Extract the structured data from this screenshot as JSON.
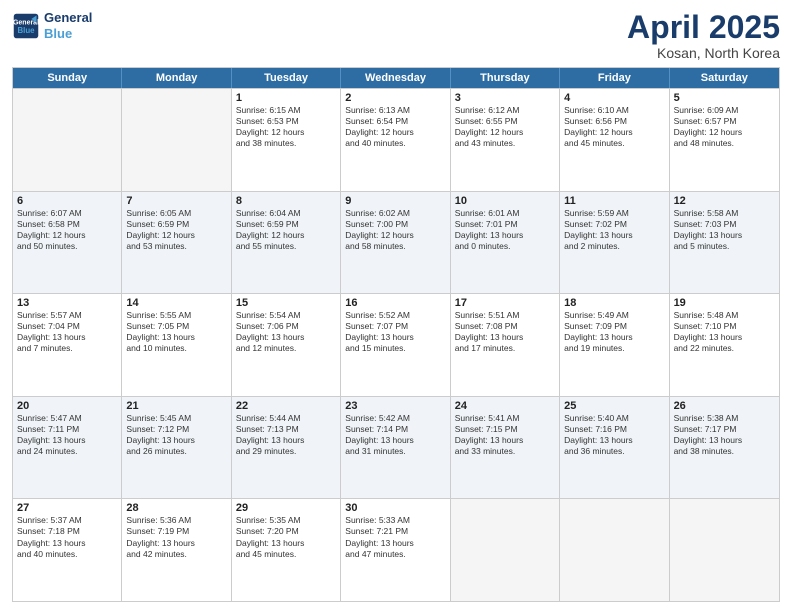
{
  "header": {
    "logo_line1": "General",
    "logo_line2": "Blue",
    "month": "April 2025",
    "location": "Kosan, North Korea"
  },
  "weekdays": [
    "Sunday",
    "Monday",
    "Tuesday",
    "Wednesday",
    "Thursday",
    "Friday",
    "Saturday"
  ],
  "rows": [
    [
      {
        "day": "",
        "lines": [],
        "empty": true
      },
      {
        "day": "",
        "lines": [],
        "empty": true
      },
      {
        "day": "1",
        "lines": [
          "Sunrise: 6:15 AM",
          "Sunset: 6:53 PM",
          "Daylight: 12 hours",
          "and 38 minutes."
        ]
      },
      {
        "day": "2",
        "lines": [
          "Sunrise: 6:13 AM",
          "Sunset: 6:54 PM",
          "Daylight: 12 hours",
          "and 40 minutes."
        ]
      },
      {
        "day": "3",
        "lines": [
          "Sunrise: 6:12 AM",
          "Sunset: 6:55 PM",
          "Daylight: 12 hours",
          "and 43 minutes."
        ]
      },
      {
        "day": "4",
        "lines": [
          "Sunrise: 6:10 AM",
          "Sunset: 6:56 PM",
          "Daylight: 12 hours",
          "and 45 minutes."
        ]
      },
      {
        "day": "5",
        "lines": [
          "Sunrise: 6:09 AM",
          "Sunset: 6:57 PM",
          "Daylight: 12 hours",
          "and 48 minutes."
        ]
      }
    ],
    [
      {
        "day": "6",
        "lines": [
          "Sunrise: 6:07 AM",
          "Sunset: 6:58 PM",
          "Daylight: 12 hours",
          "and 50 minutes."
        ]
      },
      {
        "day": "7",
        "lines": [
          "Sunrise: 6:05 AM",
          "Sunset: 6:59 PM",
          "Daylight: 12 hours",
          "and 53 minutes."
        ]
      },
      {
        "day": "8",
        "lines": [
          "Sunrise: 6:04 AM",
          "Sunset: 6:59 PM",
          "Daylight: 12 hours",
          "and 55 minutes."
        ]
      },
      {
        "day": "9",
        "lines": [
          "Sunrise: 6:02 AM",
          "Sunset: 7:00 PM",
          "Daylight: 12 hours",
          "and 58 minutes."
        ]
      },
      {
        "day": "10",
        "lines": [
          "Sunrise: 6:01 AM",
          "Sunset: 7:01 PM",
          "Daylight: 13 hours",
          "and 0 minutes."
        ]
      },
      {
        "day": "11",
        "lines": [
          "Sunrise: 5:59 AM",
          "Sunset: 7:02 PM",
          "Daylight: 13 hours",
          "and 2 minutes."
        ]
      },
      {
        "day": "12",
        "lines": [
          "Sunrise: 5:58 AM",
          "Sunset: 7:03 PM",
          "Daylight: 13 hours",
          "and 5 minutes."
        ]
      }
    ],
    [
      {
        "day": "13",
        "lines": [
          "Sunrise: 5:57 AM",
          "Sunset: 7:04 PM",
          "Daylight: 13 hours",
          "and 7 minutes."
        ]
      },
      {
        "day": "14",
        "lines": [
          "Sunrise: 5:55 AM",
          "Sunset: 7:05 PM",
          "Daylight: 13 hours",
          "and 10 minutes."
        ]
      },
      {
        "day": "15",
        "lines": [
          "Sunrise: 5:54 AM",
          "Sunset: 7:06 PM",
          "Daylight: 13 hours",
          "and 12 minutes."
        ]
      },
      {
        "day": "16",
        "lines": [
          "Sunrise: 5:52 AM",
          "Sunset: 7:07 PM",
          "Daylight: 13 hours",
          "and 15 minutes."
        ]
      },
      {
        "day": "17",
        "lines": [
          "Sunrise: 5:51 AM",
          "Sunset: 7:08 PM",
          "Daylight: 13 hours",
          "and 17 minutes."
        ]
      },
      {
        "day": "18",
        "lines": [
          "Sunrise: 5:49 AM",
          "Sunset: 7:09 PM",
          "Daylight: 13 hours",
          "and 19 minutes."
        ]
      },
      {
        "day": "19",
        "lines": [
          "Sunrise: 5:48 AM",
          "Sunset: 7:10 PM",
          "Daylight: 13 hours",
          "and 22 minutes."
        ]
      }
    ],
    [
      {
        "day": "20",
        "lines": [
          "Sunrise: 5:47 AM",
          "Sunset: 7:11 PM",
          "Daylight: 13 hours",
          "and 24 minutes."
        ]
      },
      {
        "day": "21",
        "lines": [
          "Sunrise: 5:45 AM",
          "Sunset: 7:12 PM",
          "Daylight: 13 hours",
          "and 26 minutes."
        ]
      },
      {
        "day": "22",
        "lines": [
          "Sunrise: 5:44 AM",
          "Sunset: 7:13 PM",
          "Daylight: 13 hours",
          "and 29 minutes."
        ]
      },
      {
        "day": "23",
        "lines": [
          "Sunrise: 5:42 AM",
          "Sunset: 7:14 PM",
          "Daylight: 13 hours",
          "and 31 minutes."
        ]
      },
      {
        "day": "24",
        "lines": [
          "Sunrise: 5:41 AM",
          "Sunset: 7:15 PM",
          "Daylight: 13 hours",
          "and 33 minutes."
        ]
      },
      {
        "day": "25",
        "lines": [
          "Sunrise: 5:40 AM",
          "Sunset: 7:16 PM",
          "Daylight: 13 hours",
          "and 36 minutes."
        ]
      },
      {
        "day": "26",
        "lines": [
          "Sunrise: 5:38 AM",
          "Sunset: 7:17 PM",
          "Daylight: 13 hours",
          "and 38 minutes."
        ]
      }
    ],
    [
      {
        "day": "27",
        "lines": [
          "Sunrise: 5:37 AM",
          "Sunset: 7:18 PM",
          "Daylight: 13 hours",
          "and 40 minutes."
        ]
      },
      {
        "day": "28",
        "lines": [
          "Sunrise: 5:36 AM",
          "Sunset: 7:19 PM",
          "Daylight: 13 hours",
          "and 42 minutes."
        ]
      },
      {
        "day": "29",
        "lines": [
          "Sunrise: 5:35 AM",
          "Sunset: 7:20 PM",
          "Daylight: 13 hours",
          "and 45 minutes."
        ]
      },
      {
        "day": "30",
        "lines": [
          "Sunrise: 5:33 AM",
          "Sunset: 7:21 PM",
          "Daylight: 13 hours",
          "and 47 minutes."
        ]
      },
      {
        "day": "",
        "lines": [],
        "empty": true
      },
      {
        "day": "",
        "lines": [],
        "empty": true
      },
      {
        "day": "",
        "lines": [],
        "empty": true
      }
    ]
  ]
}
